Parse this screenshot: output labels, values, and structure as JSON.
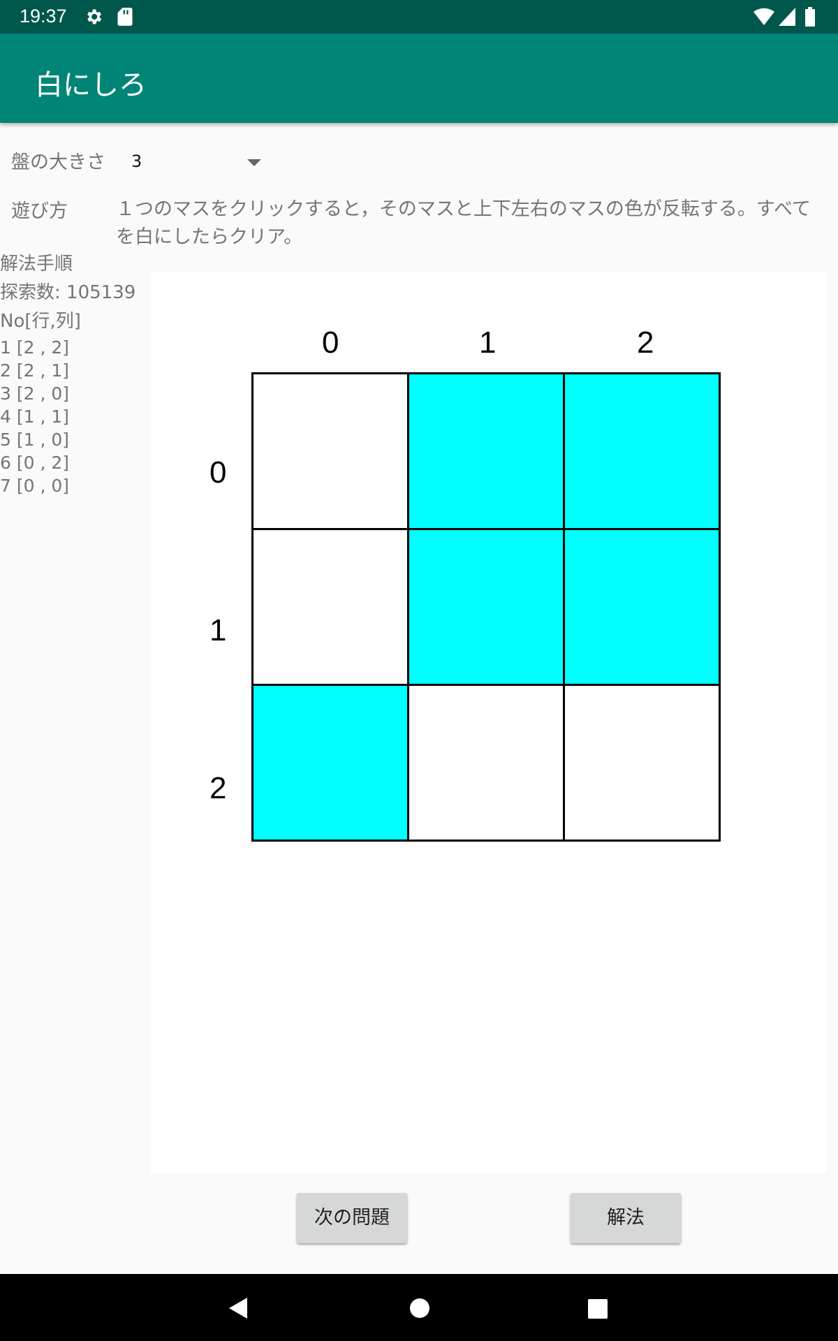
{
  "status_bar": {
    "time": "19:37",
    "icons": [
      "gear-icon",
      "sd-card-icon",
      "wifi-icon",
      "cell-signal-icon",
      "battery-icon"
    ]
  },
  "app_bar": {
    "title": "白にしろ"
  },
  "board_size": {
    "label": "盤の大きさ",
    "selected": "3"
  },
  "howto": {
    "label": "遊び方",
    "text": "１つのマスをクリックすると，そのマスと上下左右のマスの色が反転する。すべてを白にしたらクリア。"
  },
  "solution": {
    "heading": "解法手順",
    "search_count": "探索数: 105139",
    "column_header": "No[行,列]",
    "steps": [
      "1 [2 , 2]",
      "2 [2 , 1]",
      "3 [2 , 0]",
      "4 [1 , 1]",
      "5 [1 , 0]",
      "6 [0 , 2]",
      "7 [0 , 0]"
    ]
  },
  "board": {
    "col_labels": [
      "0",
      "1",
      "2"
    ],
    "row_labels": [
      "0",
      "1",
      "2"
    ],
    "cells": [
      [
        "white",
        "cyan",
        "cyan"
      ],
      [
        "white",
        "cyan",
        "cyan"
      ],
      [
        "cyan",
        "white",
        "white"
      ]
    ],
    "colors": {
      "white": "#ffffff",
      "cyan": "#00ffff"
    }
  },
  "buttons": {
    "next": "次の問題",
    "solve": "解法"
  },
  "nav_bar": {
    "icons": [
      "back-icon",
      "home-icon",
      "recents-icon"
    ]
  },
  "theme": {
    "primary": "#008577",
    "primary_dark": "#00574b"
  }
}
